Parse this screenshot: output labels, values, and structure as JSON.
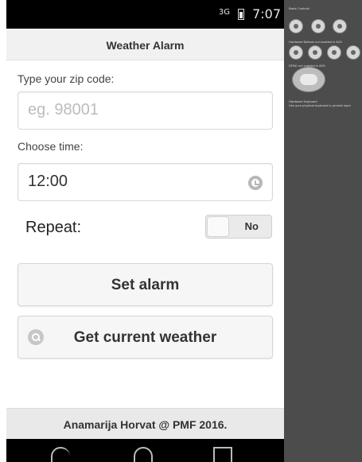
{
  "status": {
    "network": "3G",
    "time": "7:07"
  },
  "app": {
    "title": "Weather Alarm",
    "zip_label": "Type your zip code:",
    "zip_placeholder": "eg. 98001",
    "time_label": "Choose time:",
    "time_value": "12:00",
    "repeat_label": "Repeat:",
    "repeat_state": "No",
    "set_alarm_label": "Set alarm",
    "weather_label": "Get current weather",
    "footer": "Anamarija Horvat @ PMF 2016."
  },
  "side_panel": {
    "basic_controls": "Basic Controls",
    "hardware_buttons": "Hardware Buttons not enabled in AVD",
    "dpad": "DPAD not enabled in AVD",
    "hardware_keyboard": "Hardware Keyboard",
    "keyboard_hint": "Use your physical keyboard to provide input"
  }
}
